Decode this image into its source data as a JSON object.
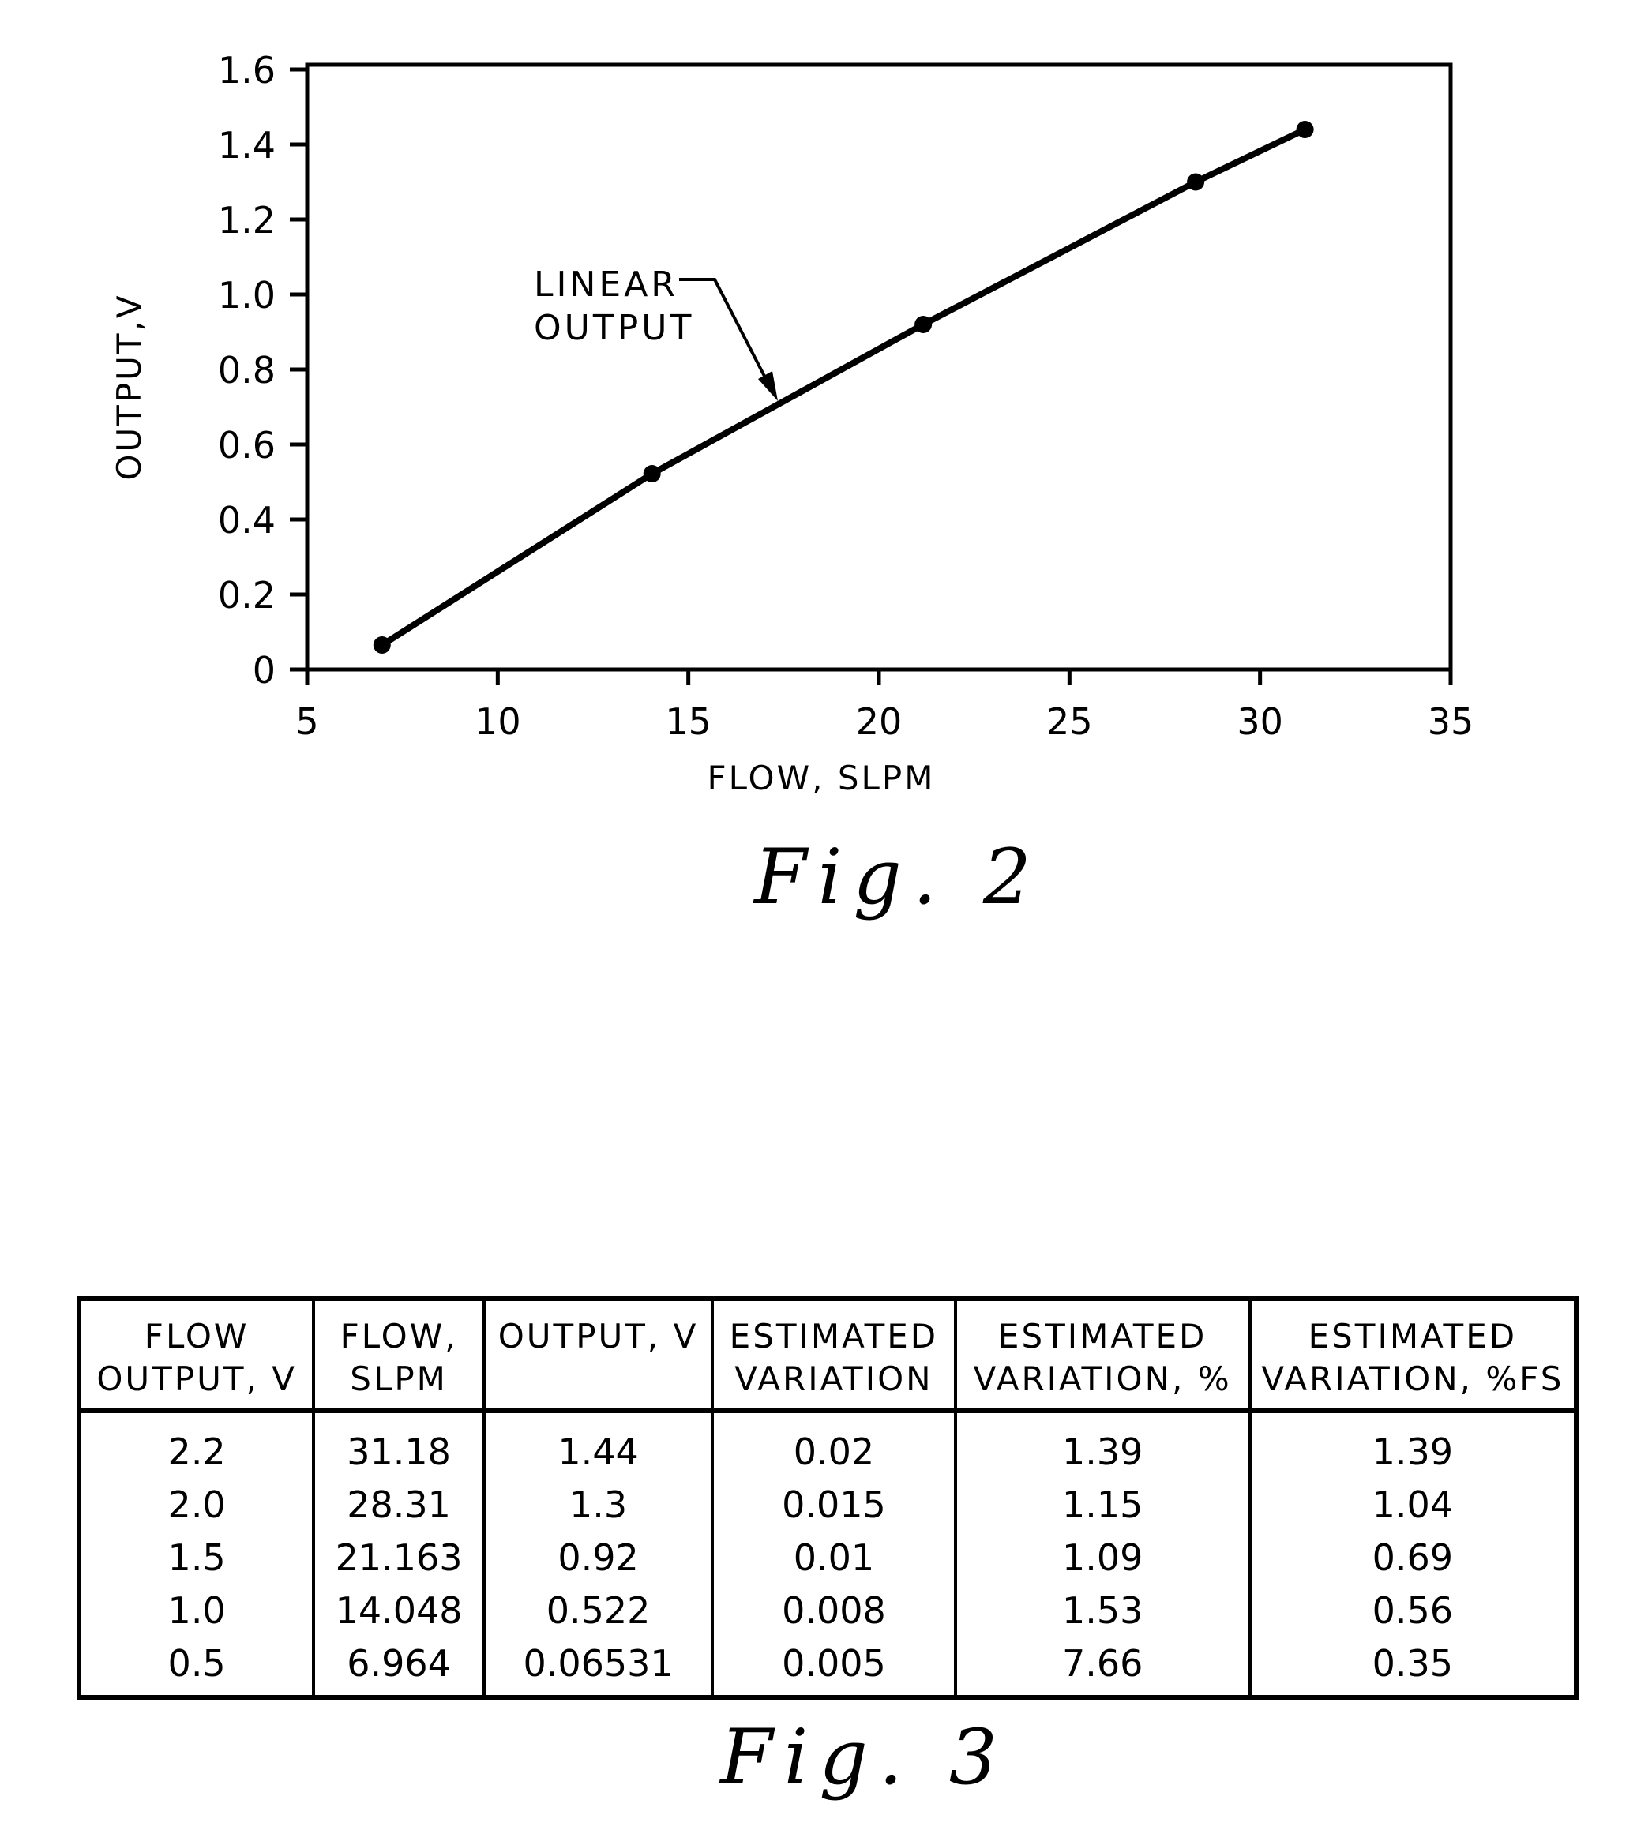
{
  "chart_data": {
    "type": "line",
    "title": "",
    "xlabel": "FLOW, SLPM",
    "ylabel": "OUTPUT,V",
    "xlim": [
      5,
      35
    ],
    "ylim": [
      0,
      1.6
    ],
    "x_ticks": [
      5,
      10,
      15,
      20,
      25,
      30,
      35
    ],
    "x_tick_labels": [
      "5",
      "10",
      "15",
      "20",
      "25",
      "30",
      "35"
    ],
    "y_ticks": [
      0,
      0.2,
      0.4,
      0.6,
      0.8,
      1.0,
      1.2,
      1.4,
      1.6
    ],
    "y_tick_labels": [
      "0",
      "0.2",
      "0.4",
      "0.6",
      "0.8",
      "1.0",
      "1.2",
      "1.4",
      "1.6"
    ],
    "grid": false,
    "series": [
      {
        "name": "LINEAR OUTPUT",
        "x": [
          6.964,
          14.048,
          21.163,
          28.31,
          31.18
        ],
        "y": [
          0.06531,
          0.522,
          0.92,
          1.3,
          1.44
        ],
        "marker": "filled-circle"
      }
    ],
    "annotations": [
      {
        "text_lines": [
          "LINEAR",
          "OUTPUT"
        ],
        "points_to": {
          "x": 17.6,
          "y": 0.73
        },
        "label_at": {
          "x": 11.2,
          "y": 0.98
        }
      }
    ]
  },
  "figures": {
    "fig2_caption": "Fig. 2",
    "fig3_caption": "Fig. 3"
  },
  "table": {
    "headers": [
      [
        "FLOW",
        "OUTPUT, V"
      ],
      [
        "FLOW,",
        "SLPM"
      ],
      [
        "OUTPUT, V",
        ""
      ],
      [
        "ESTIMATED",
        "VARIATION"
      ],
      [
        "ESTIMATED",
        "VARIATION, %"
      ],
      [
        "ESTIMATED",
        "VARIATION, %FS"
      ]
    ],
    "rows": [
      [
        "2.2",
        "31.18",
        "1.44",
        "0.02",
        "1.39",
        "1.39"
      ],
      [
        "2.0",
        "28.31",
        "1.3",
        "0.015",
        "1.15",
        "1.04"
      ],
      [
        "1.5",
        "21.163",
        "0.92",
        "0.01",
        "1.09",
        "0.69"
      ],
      [
        "1.0",
        "14.048",
        "0.522",
        "0.008",
        "1.53",
        "0.56"
      ],
      [
        "0.5",
        "6.964",
        "0.06531",
        "0.005",
        "7.66",
        "0.35"
      ]
    ]
  }
}
